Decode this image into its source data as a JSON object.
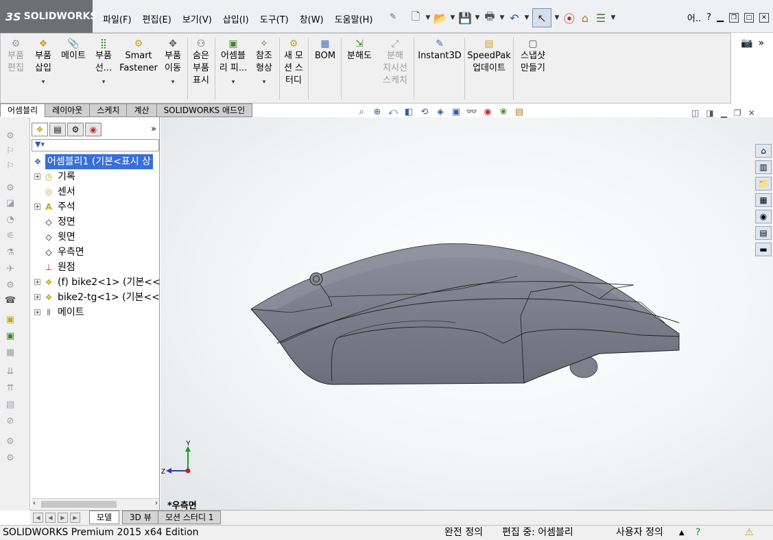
{
  "app": {
    "logo": "SOLIDWORKS"
  },
  "menu": [
    "파일(F)",
    "편집(E)",
    "보기(V)",
    "삽입(I)",
    "도구(T)",
    "창(W)",
    "도움말(H)"
  ],
  "search_label": "어..",
  "help_label": "?",
  "command_manager": {
    "buttons": [
      {
        "label1": "부품",
        "label2": "편집",
        "label3": "",
        "disabled": true
      },
      {
        "label1": "부품",
        "label2": "삽입",
        "label3": "",
        "disabled": false
      },
      {
        "label1": "메이트",
        "label2": "",
        "label3": "",
        "disabled": false
      },
      {
        "label1": "부품",
        "label2": "선...",
        "label3": "",
        "disabled": false
      },
      {
        "label1": "Smart",
        "label2": "Fastener",
        "label3": "",
        "disabled": false
      },
      {
        "label1": "부품",
        "label2": "이동",
        "label3": "",
        "disabled": false
      },
      {
        "label1": "숨은",
        "label2": "부품",
        "label3": "표시",
        "disabled": false
      },
      {
        "label1": "어셈블",
        "label2": "리 피...",
        "label3": "",
        "disabled": false
      },
      {
        "label1": "참조",
        "label2": "형상",
        "label3": "",
        "disabled": false
      },
      {
        "label1": "새 모",
        "label2": "션 스",
        "label3": "터디",
        "disabled": false
      },
      {
        "label1": "BOM",
        "label2": "",
        "label3": "",
        "disabled": false
      },
      {
        "label1": "분해도",
        "label2": "",
        "label3": "",
        "disabled": false
      },
      {
        "label1": "분해",
        "label2": "지시선",
        "label3": "스케치",
        "disabled": true
      },
      {
        "label1": "Instant3D",
        "label2": "",
        "label3": "",
        "disabled": false
      },
      {
        "label1": "SpeedPak",
        "label2": "업데이트",
        "label3": "",
        "disabled": false
      },
      {
        "label1": "스냅샷",
        "label2": "만들기",
        "label3": "",
        "disabled": false
      }
    ]
  },
  "cmd_tabs": [
    "어셈블리",
    "레이아웃",
    "스케치",
    "계산",
    "SOLIDWORKS 애드인"
  ],
  "feature_tree": [
    {
      "label": "어셈블리1  (기본<표시 상",
      "selected": true,
      "expand": ""
    },
    {
      "label": "기록",
      "selected": false,
      "expand": "+"
    },
    {
      "label": "센서",
      "selected": false,
      "expand": ""
    },
    {
      "label": "주석",
      "selected": false,
      "expand": "+"
    },
    {
      "label": "정면",
      "selected": false,
      "expand": ""
    },
    {
      "label": "윗면",
      "selected": false,
      "expand": ""
    },
    {
      "label": "우측면",
      "selected": false,
      "expand": ""
    },
    {
      "label": "원점",
      "selected": false,
      "expand": ""
    },
    {
      "label": "(f) bike2<1> (기본<<",
      "selected": false,
      "expand": "+"
    },
    {
      "label": "bike2-tg<1> (기본<<",
      "selected": false,
      "expand": "+"
    },
    {
      "label": "메이트",
      "selected": false,
      "expand": "+"
    }
  ],
  "bottom_tabs": [
    "모델",
    "3D 뷰",
    "모션 스터디 1"
  ],
  "view_name": "*우측면",
  "triad": {
    "y": "Y",
    "z": "Z"
  },
  "status": {
    "edition": "SOLIDWORKS Premium 2015 x64 Edition",
    "state": "완전 정의",
    "editing": "편집 중: 어셈블리",
    "units": "사용자 정의"
  },
  "colors": {
    "selection": "#3a6fd8",
    "model": "#7d808d",
    "accent": "#2a5ea8"
  }
}
